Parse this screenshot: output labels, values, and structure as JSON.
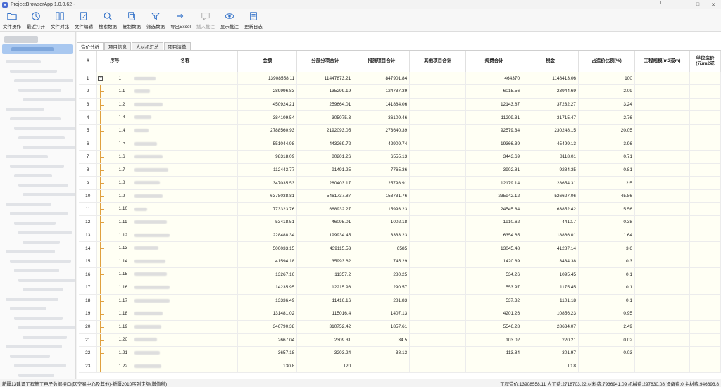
{
  "window": {
    "title": "ProjectBrowserApp 1.0.0.62 -",
    "app_icon": "app-icon",
    "controls": [
      "−",
      "□",
      "✕"
    ],
    "pin": "⟂"
  },
  "toolbar": {
    "buttons": [
      {
        "label": "文件操作",
        "icon": "folder-icon",
        "enabled": true
      },
      {
        "label": "最近打开",
        "icon": "clock-icon",
        "enabled": true
      },
      {
        "label": "文件对比",
        "icon": "compare-icon",
        "enabled": true
      },
      {
        "label": "文件编辑",
        "icon": "edit-icon",
        "enabled": true
      },
      {
        "label": "搜索数据",
        "icon": "search-icon",
        "enabled": true
      },
      {
        "label": "复制数据",
        "icon": "copy-icon",
        "enabled": true
      },
      {
        "label": "筛选数据",
        "icon": "filter-icon",
        "enabled": true
      },
      {
        "label": "导出Excel",
        "icon": "export-excel-icon",
        "enabled": true
      },
      {
        "label": "插入批注",
        "icon": "comment-icon",
        "enabled": false
      },
      {
        "label": "显示批注",
        "icon": "eye-icon",
        "enabled": true
      },
      {
        "label": "更新日志",
        "icon": "log-icon",
        "enabled": true
      }
    ]
  },
  "tabs": [
    "造价分析",
    "项目信息",
    "人材机汇总",
    "项目清单"
  ],
  "table": {
    "headers": [
      "#",
      "序号",
      "名称",
      "金额",
      "分部分项合计",
      "措施项目合计",
      "其他项目合计",
      "规费合计",
      "税金",
      "占造价比例(%)",
      "工程规模(m2或m)",
      "单位造价\n(元/m2或"
    ],
    "rows": [
      [
        "1",
        "1",
        "13908558.11",
        "11447873.21",
        "847901.84",
        "",
        "464370",
        "1148413.06",
        "100"
      ],
      [
        "2",
        "1.1",
        "289996.83",
        "135299.19",
        "124737.39",
        "",
        "6015.56",
        "23944.69",
        "2.09"
      ],
      [
        "3",
        "1.2",
        "450924.21",
        "259664.01",
        "141884.06",
        "",
        "12143.87",
        "37232.27",
        "3.24"
      ],
      [
        "4",
        "1.3",
        "384109.54",
        "305075.3",
        "36109.46",
        "",
        "11209.31",
        "31715.47",
        "2.76"
      ],
      [
        "5",
        "1.4",
        "2788560.93",
        "2192093.05",
        "273640.39",
        "",
        "92579.34",
        "230248.15",
        "20.05"
      ],
      [
        "6",
        "1.5",
        "551044.98",
        "443269.72",
        "42909.74",
        "",
        "19366.39",
        "45499.13",
        "3.96"
      ],
      [
        "7",
        "1.6",
        "98318.09",
        "80201.26",
        "6555.13",
        "",
        "3443.69",
        "8118.01",
        "0.71"
      ],
      [
        "8",
        "1.7",
        "112443.77",
        "91491.25",
        "7765.36",
        "",
        "3902.81",
        "9284.35",
        "0.81"
      ],
      [
        "9",
        "1.8",
        "347035.53",
        "280403.17",
        "25798.91",
        "",
        "12179.14",
        "28654.31",
        "2.5"
      ],
      [
        "10",
        "1.9",
        "6378038.81",
        "5461737.87",
        "153731.76",
        "",
        "235942.12",
        "526627.06",
        "45.86"
      ],
      [
        "11",
        "1.10",
        "773323.76",
        "668932.27",
        "15993.23",
        "",
        "24545.84",
        "63852.42",
        "5.56"
      ],
      [
        "12",
        "1.11",
        "53418.51",
        "46095.01",
        "1002.18",
        "",
        "1910.62",
        "4410.7",
        "0.38"
      ],
      [
        "13",
        "1.12",
        "228488.34",
        "199934.45",
        "3333.23",
        "",
        "6354.65",
        "18866.01",
        "1.64"
      ],
      [
        "14",
        "1.13",
        "500033.15",
        "439115.53",
        "6585",
        "",
        "13045.48",
        "41287.14",
        "3.6"
      ],
      [
        "15",
        "1.14",
        "41594.18",
        "35993.62",
        "745.29",
        "",
        "1420.89",
        "3434.38",
        "0.3"
      ],
      [
        "16",
        "1.15",
        "13267.16",
        "11357.2",
        "280.25",
        "",
        "534.26",
        "1095.45",
        "0.1"
      ],
      [
        "17",
        "1.16",
        "14235.95",
        "12215.96",
        "290.57",
        "",
        "553.97",
        "1175.45",
        "0.1"
      ],
      [
        "18",
        "1.17",
        "13336.49",
        "11416.16",
        "281.83",
        "",
        "537.32",
        "1101.18",
        "0.1"
      ],
      [
        "19",
        "1.18",
        "131481.02",
        "115016.4",
        "1407.13",
        "",
        "4201.26",
        "10856.23",
        "0.95"
      ],
      [
        "20",
        "1.19",
        "346790.38",
        "310752.42",
        "1857.61",
        "",
        "5546.28",
        "28634.07",
        "2.49"
      ],
      [
        "21",
        "1.20",
        "2667.04",
        "2309.31",
        "34.5",
        "",
        "103.02",
        "220.21",
        "0.02"
      ],
      [
        "22",
        "1.21",
        "3657.18",
        "3203.24",
        "38.13",
        "",
        "113.84",
        "301.97",
        "0.03"
      ],
      [
        "23",
        "1.22",
        "130.8",
        "120",
        "",
        "",
        "",
        "10.8",
        ""
      ]
    ]
  },
  "status": {
    "left": "新疆13建设工程施工电子数据接口(区交易中心及其他)-新疆2010序列定额(增值税)",
    "right": "工程造价:13908558.11 人工费:2718703.22 材料费:7936941.09 机械费:297830.08 设备费:0 主材费:946693.8"
  }
}
